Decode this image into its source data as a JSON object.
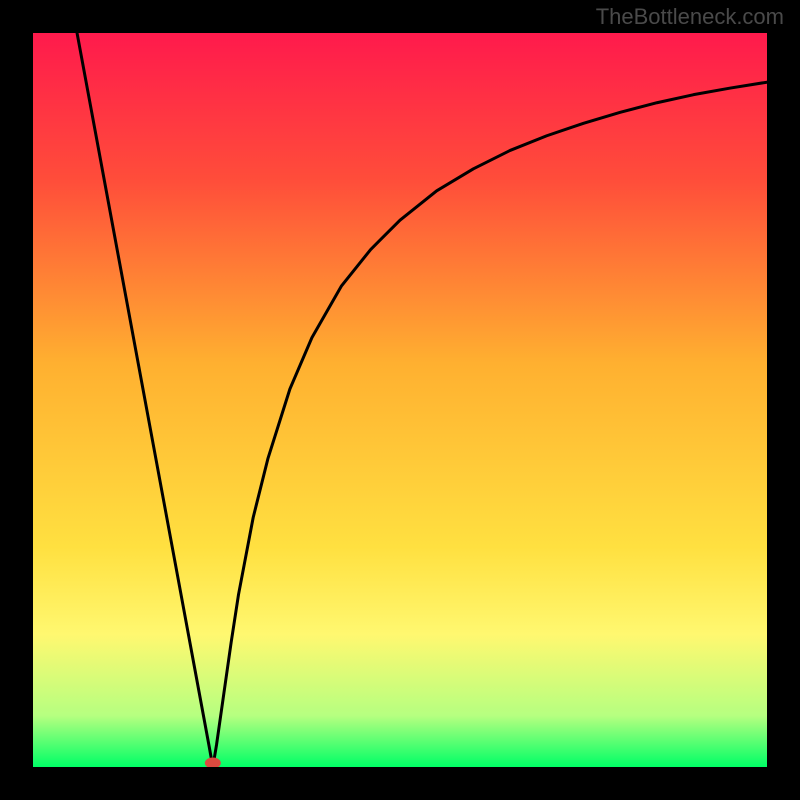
{
  "watermark": "TheBottleneck.com",
  "chart_data": {
    "type": "line",
    "title": "",
    "xlabel": "",
    "ylabel": "",
    "xlim": [
      0,
      100
    ],
    "ylim": [
      0,
      100
    ],
    "min_marker": {
      "x": 24.5,
      "y": 0
    },
    "series": [
      {
        "name": "curve",
        "x": [
          6,
          8,
          10,
          12,
          14,
          16,
          18,
          20,
          22,
          23,
          24,
          24.5,
          25,
          26,
          27,
          28,
          30,
          32,
          35,
          38,
          42,
          46,
          50,
          55,
          60,
          65,
          70,
          75,
          80,
          85,
          90,
          95,
          100
        ],
        "y": [
          100,
          89.2,
          78.4,
          67.6,
          56.8,
          46.0,
          35.2,
          24.4,
          13.6,
          8.2,
          2.8,
          0.0,
          3.0,
          10.0,
          17.0,
          23.5,
          34.0,
          42.0,
          51.5,
          58.5,
          65.5,
          70.5,
          74.5,
          78.5,
          81.5,
          84.0,
          86.0,
          87.7,
          89.2,
          90.5,
          91.6,
          92.5,
          93.3
        ]
      }
    ],
    "gradient_stops": [
      {
        "offset": 0.0,
        "color": "#ff1a4c"
      },
      {
        "offset": 0.2,
        "color": "#ff4d3a"
      },
      {
        "offset": 0.45,
        "color": "#ffb030"
      },
      {
        "offset": 0.7,
        "color": "#ffe040"
      },
      {
        "offset": 0.82,
        "color": "#fff870"
      },
      {
        "offset": 0.93,
        "color": "#b6ff80"
      },
      {
        "offset": 1.0,
        "color": "#00ff66"
      }
    ]
  }
}
